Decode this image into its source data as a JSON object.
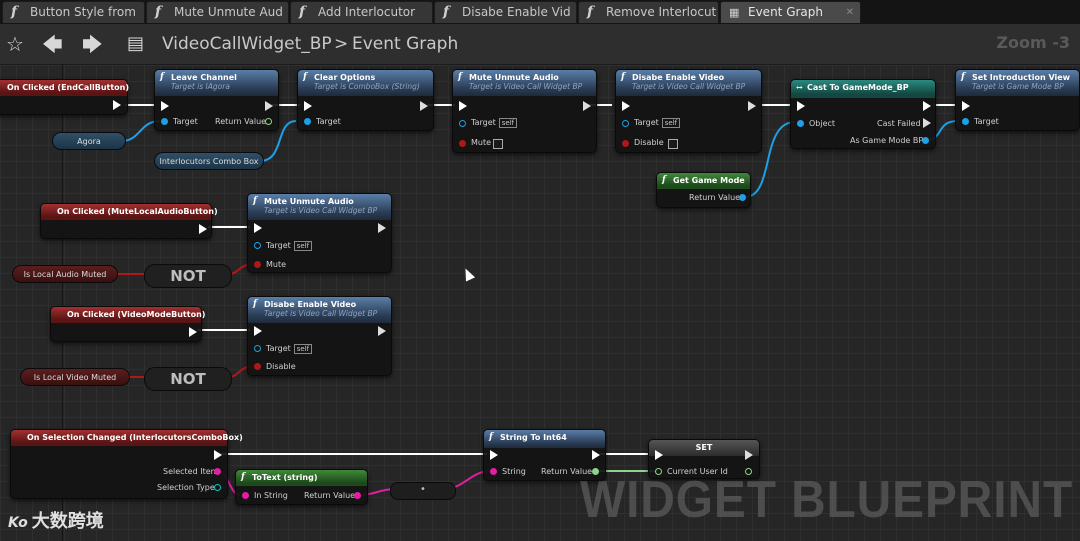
{
  "tabs": [
    {
      "label": "Button Style from"
    },
    {
      "label": "Mute Unmute Aud"
    },
    {
      "label": "Add Interlocutor"
    },
    {
      "label": "Disabe Enable Vid"
    },
    {
      "label": "Remove Interlocut"
    },
    {
      "label": "Event Graph"
    }
  ],
  "toolbar": {
    "breadcrumb_root": "VideoCallWidget_BP",
    "breadcrumb_sep": ">",
    "breadcrumb_leaf": "Event Graph",
    "zoom": "Zoom -3",
    "icons": [
      "star-icon",
      "back-arrow-icon",
      "forward-arrow-icon",
      "blueprint-icon"
    ]
  },
  "nodes": {
    "end_call": {
      "title": "On Clicked (EndCallButton)"
    },
    "leave": {
      "title": "Leave Channel",
      "sub": "Target is IAgora",
      "target": "Target",
      "ret": "Return Value"
    },
    "clear": {
      "title": "Clear Options",
      "sub": "Target is ComboBox (String)",
      "target": "Target"
    },
    "mute1": {
      "title": "Mute Unmute Audio",
      "sub": "Target is Video Call Widget BP",
      "target": "Target",
      "self": "self",
      "mute": "Mute"
    },
    "disable1": {
      "title": "Disabe Enable Video",
      "sub": "Target is Video Call Widget BP",
      "target": "Target",
      "self": "self",
      "disable": "Disable"
    },
    "cast": {
      "title": "Cast To GameMode_BP",
      "object": "Object",
      "failed": "Cast Failed",
      "as": "As Game Mode BP"
    },
    "intro": {
      "title": "Set Introduction View",
      "sub": "Target is Game Mode BP",
      "target": "Target"
    },
    "get_game_mode": {
      "title": "Get Game Mode",
      "ret": "Return Value"
    },
    "agora": {
      "label": "Agora"
    },
    "combo": {
      "label": "Interlocutors Combo Box"
    },
    "mute_local": {
      "title": "On Clicked (MuteLocalAudioButton)"
    },
    "mute2": {
      "title": "Mute Unmute Audio",
      "sub": "Target is Video Call Widget BP",
      "target": "Target",
      "self": "self",
      "mute": "Mute"
    },
    "is_audio_muted": {
      "label": "Is Local Audio Muted"
    },
    "not1": {
      "label": "NOT"
    },
    "video_mode": {
      "title": "On Clicked (VideoModeButton)"
    },
    "disable2": {
      "title": "Disabe Enable Video",
      "sub": "Target is Video Call Widget BP",
      "target": "Target",
      "self": "self",
      "disable": "Disable"
    },
    "is_video_muted": {
      "label": "Is Local Video Muted"
    },
    "not2": {
      "label": "NOT"
    },
    "sel_changed": {
      "title": "On Selection Changed (InterlocutorsComboBox)",
      "item": "Selected Item",
      "type": "Selection Type"
    },
    "totext": {
      "title": "ToText (string)",
      "in": "In String",
      "ret": "Return Value"
    },
    "dot": {
      "label": "•"
    },
    "str2int": {
      "title": "String To Int64",
      "in": "String",
      "ret": "Return Value"
    },
    "set": {
      "title": "SET",
      "field": "Current User Id"
    }
  },
  "watermark": "WIDGET BLUEPRINT",
  "brand": {
    "logo": "Ko",
    "text": "大数跨境"
  }
}
